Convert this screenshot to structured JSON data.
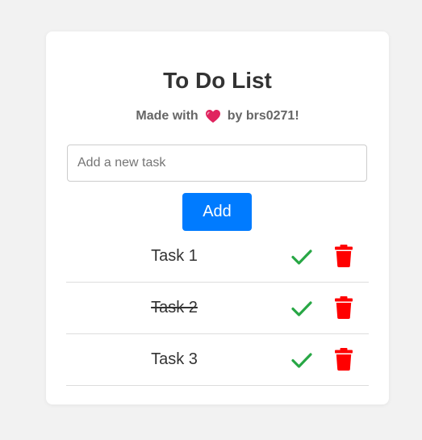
{
  "app": {
    "title": "To Do List",
    "subtitle_before": "Made with",
    "subtitle_after": "by brs0271!",
    "heart_icon": "heart-icon"
  },
  "input": {
    "placeholder": "Add a new task",
    "value": ""
  },
  "add_button": {
    "label": "Add"
  },
  "tasks": [
    {
      "text": "Task 1",
      "completed": false
    },
    {
      "text": "Task 2",
      "completed": true
    },
    {
      "text": "Task 3",
      "completed": false
    }
  ],
  "icons": {
    "complete": "check-icon",
    "delete": "trash-icon"
  },
  "colors": {
    "accent": "#007bff",
    "check": "#28a745",
    "delete": "#ff0000",
    "heart": "#e0245e"
  }
}
